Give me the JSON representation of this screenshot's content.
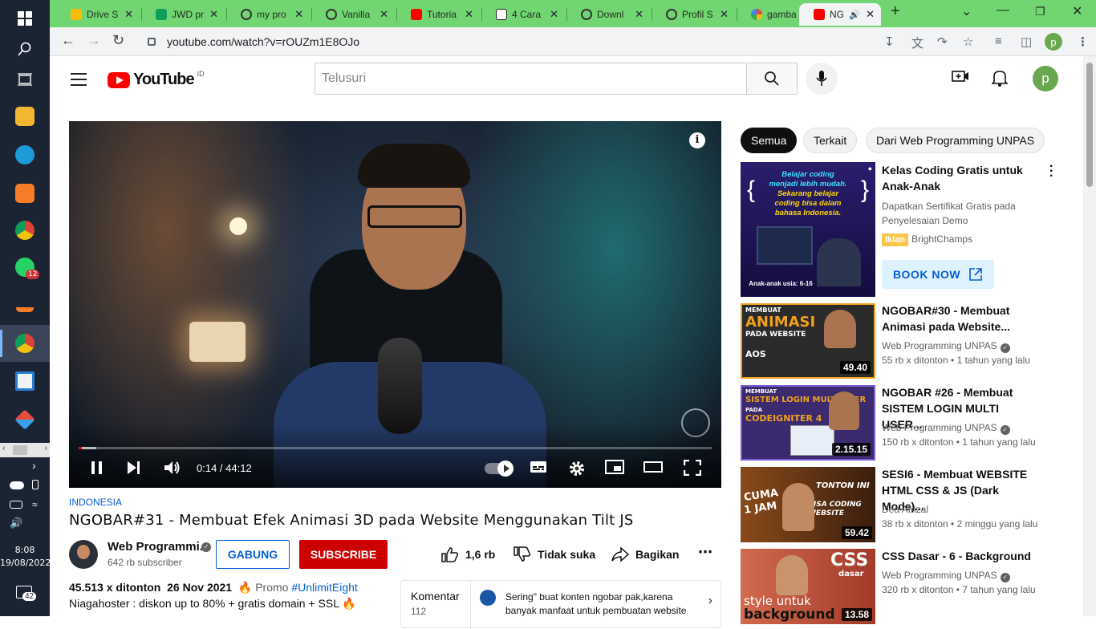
{
  "os": {
    "taskbar_badge": "12",
    "clock": {
      "time": "8:08",
      "date": "19/08/2022"
    },
    "notif_count": "42"
  },
  "browser": {
    "tabs": [
      {
        "title": "Drive S",
        "color": "#fbbc04"
      },
      {
        "title": "JWD pr",
        "color": "#0f9d58"
      },
      {
        "title": "my pro",
        "color": "#444444"
      },
      {
        "title": "Vanilla",
        "color": "#444444"
      },
      {
        "title": "Tutoria",
        "color": "#ff0000"
      },
      {
        "title": "4 Cara",
        "color": "#222222"
      },
      {
        "title": "Downl",
        "color": "#444444"
      },
      {
        "title": "Profil S",
        "color": "#444444"
      },
      {
        "title": "gamba",
        "color": "#4285f4"
      },
      {
        "title": "NG",
        "color": "#ff0000"
      }
    ],
    "url": "youtube.com/watch?v=rOUZm1E8OJo",
    "profile_initial": "p"
  },
  "youtube": {
    "logo_text": "YouTube",
    "country_code": "ID",
    "search_placeholder": "Telusuri",
    "avatar_initial": "p",
    "player": {
      "current_time": "0:14",
      "duration": "44:12",
      "time_display": "0:14 / 44:12",
      "progress_played": 0.005,
      "progress_loaded": 0.028
    },
    "video": {
      "hashtag": "INDONESIA",
      "title": "NGOBAR#31 - Membuat Efek Animasi 3D pada Website Menggunakan Tilt JS",
      "channel": "Web Programmi...",
      "subscribers": "642 rb subscriber",
      "join_label": "GABUNG",
      "subscribe_label": "SUBSCRIBE",
      "likes": "1,6 rb",
      "dislike_label": "Tidak suka",
      "share_label": "Bagikan",
      "views": "45.513 x ditonton",
      "date": "26 Nov 2021",
      "promo_prefix": "Promo",
      "promo_tag": "#UnlimitEight",
      "desc_line2": "Niagahoster : diskon up to 80% + gratis domain + SSL"
    },
    "comments": {
      "label": "Komentar",
      "count": "112",
      "preview": "Sering\" buat konten ngobar pak,karena banyak manfaat untuk pembuatan website"
    },
    "chips": [
      "Semua",
      "Terkait",
      "Dari Web Programming UNPAS"
    ],
    "ad": {
      "thumb_lines": [
        "Belajar coding",
        "menjadi lebih mudah.",
        "Sekarang belajar",
        "coding bisa dalam",
        "bahasa Indonesia."
      ],
      "thumb_footer": "Anak-anak usia: 6-16",
      "title": "Kelas Coding Gratis untuk Anak-Anak",
      "desc": "Dapatkan Sertifikat Gratis pada Penyelesaian Demo",
      "badge": "Iklan",
      "advertiser": "BrightChamps",
      "cta": "BOOK NOW"
    },
    "recommendations": [
      {
        "title": "NGOBAR#30 - Membuat Animasi pada Website...",
        "channel": "Web Programming UNPAS",
        "verified": true,
        "meta": "55 rb x ditonton • 1 tahun yang lalu",
        "duration": "49.40",
        "thumb_text": [
          "MEMBUAT",
          "ANIMASI",
          "PADA WEBSITE",
          "AOS"
        ],
        "thumb_bg": "#2b2b2b"
      },
      {
        "title": "NGOBAR #26 - Membuat SISTEM LOGIN MULTI USER...",
        "channel": "Web Programming UNPAS",
        "verified": true,
        "meta": "150 rb x ditonton • 1 tahun yang lalu",
        "duration": "2.15.15",
        "thumb_text": [
          "MEMBUAT",
          "SISTEM LOGIN MULTI USER",
          "PADA",
          "CODEIGNITER 4"
        ],
        "thumb_bg": "#3b2a6e"
      },
      {
        "title": "SESI6 - Membuat WEBSITE HTML CSS & JS (Dark Mode)...",
        "channel": "Dea Afrizal",
        "verified": false,
        "meta": "38 rb x ditonton • 2 minggu yang lalu",
        "duration": "59.42",
        "thumb_text": [
          "CUMA",
          "1 JAM",
          "TONTON INI",
          "BISA CODING WEBSITE"
        ],
        "thumb_bg": "#8a4a1a"
      },
      {
        "title": "CSS Dasar - 6 - Background",
        "channel": "Web Programming UNPAS",
        "verified": true,
        "meta": "320 rb x ditonton • 7 tahun yang lalu",
        "duration": "13.58",
        "thumb_text": [
          "CSS",
          "dasar",
          "style untuk",
          "background"
        ],
        "thumb_bg": "#b34a36"
      }
    ]
  }
}
